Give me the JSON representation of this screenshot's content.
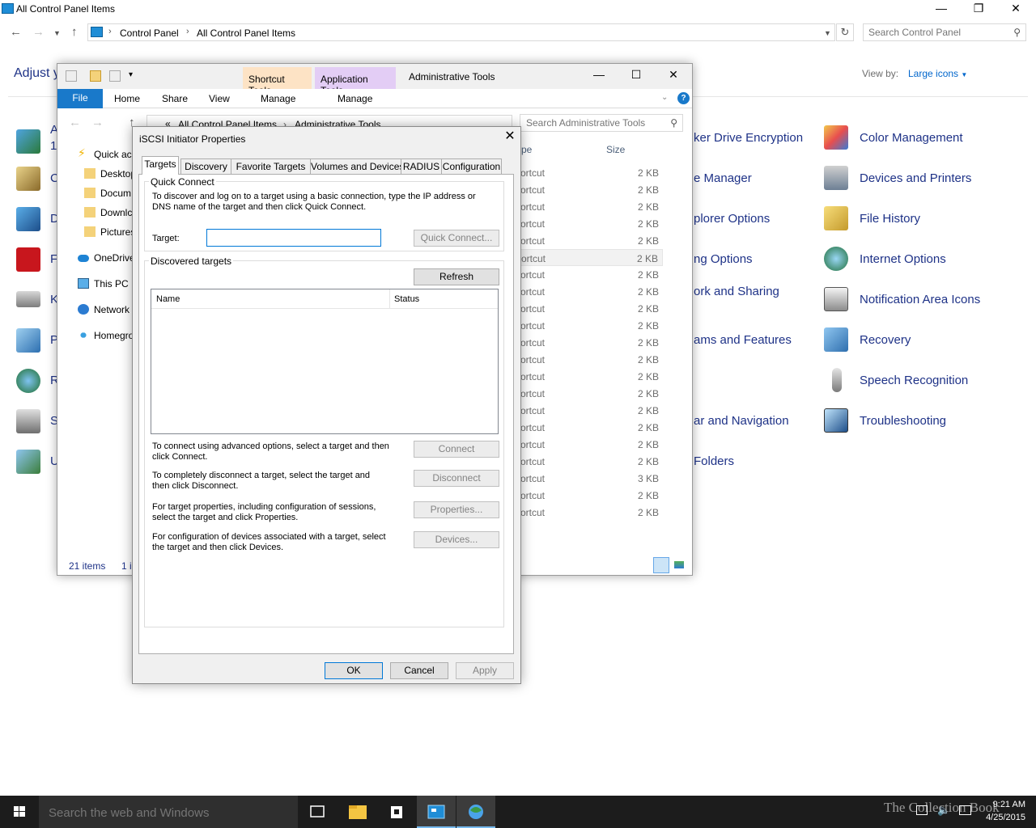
{
  "control_panel": {
    "window_title": "All Control Panel Items",
    "breadcrumb": [
      "Control Panel",
      "All Control Panel Items"
    ],
    "search_placeholder": "Search Control Panel",
    "heading": "Adjust y",
    "view_by_label": "View by:",
    "view_by_value": "Large icons",
    "left_fragments": [
      "A",
      "1",
      "C",
      "D",
      "F",
      "K",
      "P",
      "R",
      "S",
      "U"
    ],
    "middle_items": [
      "ker Drive Encryption",
      "e Manager",
      "plorer Options",
      "ng Options",
      "ork and Sharing",
      "ams and Features",
      "ar and Navigation",
      "Folders"
    ],
    "right_items": [
      "Color Management",
      "Devices and Printers",
      "File History",
      "Internet Options",
      "Notification Area Icons",
      "Recovery",
      "Speech Recognition",
      "Troubleshooting"
    ]
  },
  "admin_tools": {
    "window_title": "Administrative Tools",
    "context_tabs": [
      "Shortcut Tools",
      "Application Tools"
    ],
    "ribbon_tabs": {
      "file": "File",
      "home": "Home",
      "share": "Share",
      "view": "View",
      "manage1": "Manage",
      "manage2": "Manage"
    },
    "breadcrumb_prefix": "«",
    "breadcrumb": [
      "All Control Panel Items",
      "Administrative Tools"
    ],
    "search_placeholder": "Search Administrative Tools",
    "nav": [
      "Quick ac",
      "Desktop",
      "Docum",
      "Downlc",
      "Pictures",
      "OneDrive",
      "This PC",
      "Network",
      "Homegro"
    ],
    "col_type": "pe",
    "col_size": "Size",
    "rows": [
      {
        "type": "ortcut",
        "size": "2 KB"
      },
      {
        "type": "ortcut",
        "size": "2 KB"
      },
      {
        "type": "ortcut",
        "size": "2 KB"
      },
      {
        "type": "ortcut",
        "size": "2 KB"
      },
      {
        "type": "ortcut",
        "size": "2 KB"
      },
      {
        "type": "ortcut",
        "size": "2 KB"
      },
      {
        "type": "ortcut",
        "size": "2 KB"
      },
      {
        "type": "ortcut",
        "size": "2 KB"
      },
      {
        "type": "ortcut",
        "size": "2 KB"
      },
      {
        "type": "ortcut",
        "size": "2 KB"
      },
      {
        "type": "ortcut",
        "size": "2 KB"
      },
      {
        "type": "ortcut",
        "size": "2 KB"
      },
      {
        "type": "ortcut",
        "size": "2 KB"
      },
      {
        "type": "ortcut",
        "size": "2 KB"
      },
      {
        "type": "ortcut",
        "size": "2 KB"
      },
      {
        "type": "ortcut",
        "size": "2 KB"
      },
      {
        "type": "ortcut",
        "size": "2 KB"
      },
      {
        "type": "ortcut",
        "size": "2 KB"
      },
      {
        "type": "ortcut",
        "size": "3 KB"
      },
      {
        "type": "ortcut",
        "size": "2 KB"
      },
      {
        "type": "ortcut",
        "size": "2 KB"
      }
    ],
    "status_count": "21 items",
    "status_sel": "1 i"
  },
  "dialog": {
    "title": "iSCSI Initiator Properties",
    "tabs": [
      "Targets",
      "Discovery",
      "Favorite Targets",
      "Volumes and Devices",
      "RADIUS",
      "Configuration"
    ],
    "quick_connect": {
      "group_title": "Quick Connect",
      "description": "To discover and log on to a target using a basic connection, type the IP address or DNS name of the target and then click Quick Connect.",
      "target_label": "Target:",
      "target_value": "",
      "quick_connect_btn": "Quick Connect..."
    },
    "discovered": {
      "group_title": "Discovered targets",
      "refresh_btn": "Refresh",
      "col_name": "Name",
      "col_status": "Status"
    },
    "actions": [
      {
        "text": "To connect using advanced options, select a target and then click Connect.",
        "button": "Connect"
      },
      {
        "text": "To completely disconnect a target, select the target and then click Disconnect.",
        "button": "Disconnect"
      },
      {
        "text": "For target properties, including configuration of sessions, select the target and click Properties.",
        "button": "Properties..."
      },
      {
        "text": "For configuration of devices associated with a target, select the target and then click Devices.",
        "button": "Devices..."
      }
    ],
    "ok": "OK",
    "cancel": "Cancel",
    "apply": "Apply"
  },
  "taskbar": {
    "search_placeholder": "Search the web and Windows",
    "time": "9:21 AM",
    "date": "4/25/2015",
    "watermark": "The Collection Book"
  },
  "colors": {
    "accent": "#1979ca",
    "link": "#1e3287",
    "context_shortcut": "#fde3c5",
    "context_application": "#e3cdf5"
  }
}
